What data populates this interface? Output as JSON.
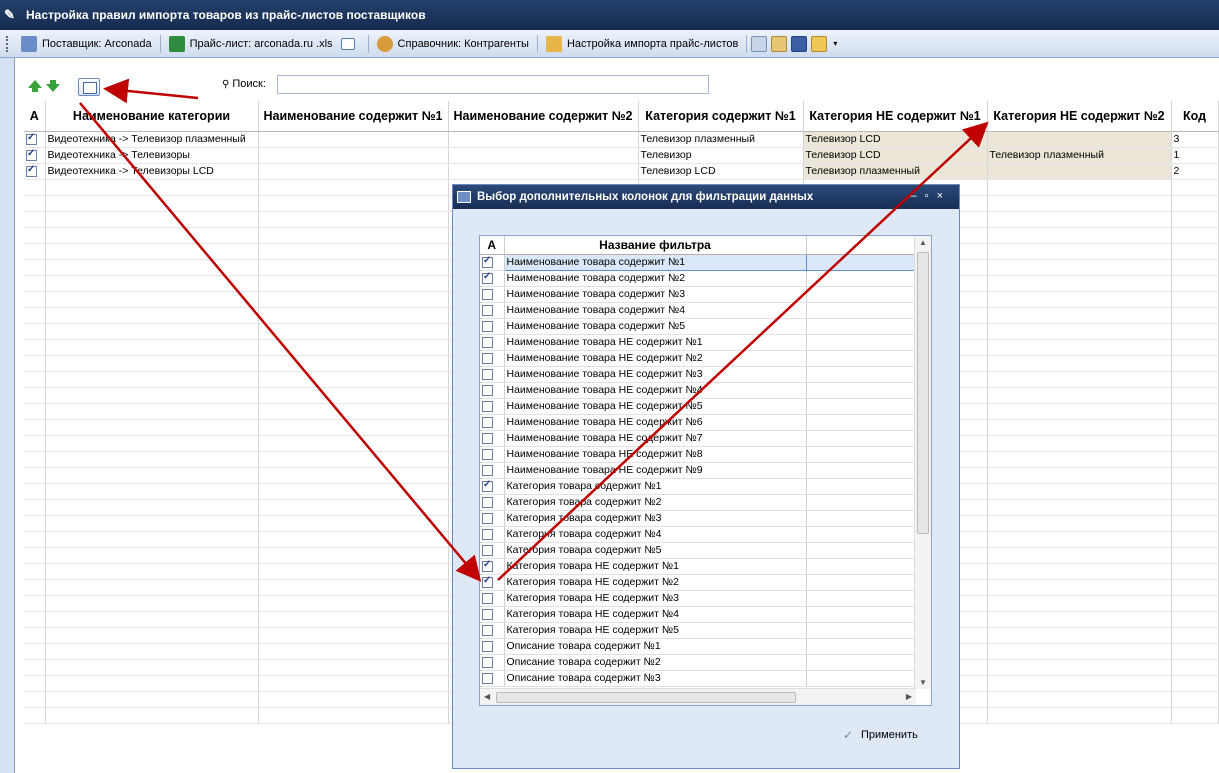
{
  "window": {
    "title": "Настройка правил импорта товаров из прайс-листов поставщиков"
  },
  "toolbar": {
    "supplier": "Поставщик: Arconada",
    "pricelist": "Прайс-лист: arconada.ru .xls",
    "directory": "Справочник: Контрагенты",
    "import_settings": "Настройка импорта прайс-листов"
  },
  "search": {
    "label": "Поиск:",
    "value": ""
  },
  "grid": {
    "headers": [
      "А",
      "Наименование категории",
      "Наименование содержит №1",
      "Наименование содержит №2",
      "Категория содержит №1",
      "Категория НЕ содержит №1",
      "Категория НЕ содержит №2",
      "Код"
    ],
    "rows": [
      {
        "checked": true,
        "name": "Видеотехника -> Телевизор плазменный",
        "n1": "",
        "n2": "",
        "c1": "Телевизор плазменный",
        "nc1": "Телевизор LCD",
        "nc2": "",
        "code": "3"
      },
      {
        "checked": true,
        "name": "Видеотехника -> Телевизоры",
        "n1": "",
        "n2": "",
        "c1": "Телевизор",
        "nc1": "Телевизор LCD",
        "nc2": "Телевизор плазменный",
        "code": "1"
      },
      {
        "checked": true,
        "name": "Видеотехника -> Телевизоры LCD",
        "n1": "",
        "n2": "",
        "c1": "Телевизор LCD",
        "nc1": "Телевизор плазменный",
        "nc2": "",
        "code": "2"
      }
    ]
  },
  "dialog": {
    "title": "Выбор дополнительных колонок для фильтрации данных",
    "col_a": "А",
    "col_name": "Название фильтра",
    "apply": "Применить",
    "filters": [
      {
        "label": "Наименование товара содержит №1",
        "checked": true
      },
      {
        "label": "Наименование товара содержит №2",
        "checked": true
      },
      {
        "label": "Наименование товара содержит №3",
        "checked": false
      },
      {
        "label": "Наименование товара содержит №4",
        "checked": false
      },
      {
        "label": "Наименование товара содержит №5",
        "checked": false
      },
      {
        "label": "Наименование товара НЕ содержит №1",
        "checked": false
      },
      {
        "label": "Наименование товара НЕ содержит №2",
        "checked": false
      },
      {
        "label": "Наименование товара НЕ содержит №3",
        "checked": false
      },
      {
        "label": "Наименование товара НЕ содержит №4",
        "checked": false
      },
      {
        "label": "Наименование товара НЕ содержит №5",
        "checked": false
      },
      {
        "label": "Наименование товара НЕ содержит №6",
        "checked": false
      },
      {
        "label": "Наименование товара НЕ содержит №7",
        "checked": false
      },
      {
        "label": "Наименование товара НЕ содержит №8",
        "checked": false
      },
      {
        "label": "Наименование товара НЕ содержит №9",
        "checked": false
      },
      {
        "label": "Категория товара содержит №1",
        "checked": true
      },
      {
        "label": "Категория товара содержит №2",
        "checked": false
      },
      {
        "label": "Категория товара содержит №3",
        "checked": false
      },
      {
        "label": "Категория товара содержит №4",
        "checked": false
      },
      {
        "label": "Категория товара содержит №5",
        "checked": false
      },
      {
        "label": "Категория товара НЕ содержит №1",
        "checked": true
      },
      {
        "label": "Категория товара НЕ содержит №2",
        "checked": true
      },
      {
        "label": "Категория товара НЕ содержит №3",
        "checked": false
      },
      {
        "label": "Категория товара НЕ содержит №4",
        "checked": false
      },
      {
        "label": "Категория товара НЕ содержит №5",
        "checked": false
      },
      {
        "label": "Описание товара содержит №1",
        "checked": false
      },
      {
        "label": "Описание товара содержит №2",
        "checked": false
      },
      {
        "label": "Описание товара содержит №3",
        "checked": false
      }
    ]
  },
  "colors": {
    "title_bg": "#1e3a66",
    "selected_row": "#dbe8fa",
    "tan_cell": "#ece6d8",
    "annotation_arrow": "#c00000"
  }
}
